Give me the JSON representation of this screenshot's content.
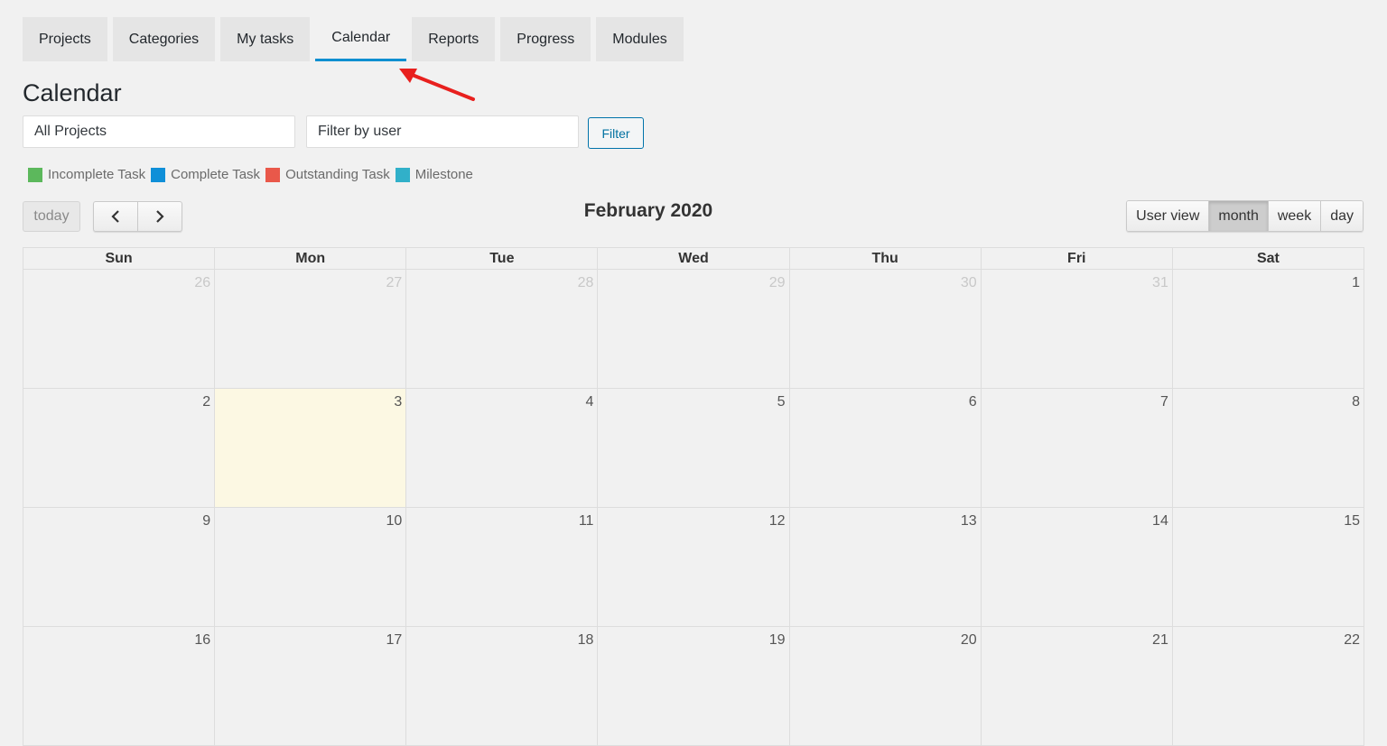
{
  "tabs": [
    {
      "label": "Projects",
      "active": false
    },
    {
      "label": "Categories",
      "active": false
    },
    {
      "label": "My tasks",
      "active": false
    },
    {
      "label": "Calendar",
      "active": true
    },
    {
      "label": "Reports",
      "active": false
    },
    {
      "label": "Progress",
      "active": false
    },
    {
      "label": "Modules",
      "active": false
    }
  ],
  "page_title": "Calendar",
  "filters": {
    "project_value": "All Projects",
    "user_placeholder": "Filter by user",
    "filter_button": "Filter"
  },
  "legend": [
    {
      "label": "Incomplete Task",
      "color": "#5cb85c"
    },
    {
      "label": "Complete Task",
      "color": "#0f8fd8"
    },
    {
      "label": "Outstanding Task",
      "color": "#e9584a"
    },
    {
      "label": "Milestone",
      "color": "#31b0c9"
    }
  ],
  "toolbar": {
    "today_label": "today",
    "prev_icon": "‹",
    "next_icon": "›",
    "title": "February 2020",
    "views": [
      {
        "label": "User view",
        "active": false
      },
      {
        "label": "month",
        "active": true
      },
      {
        "label": "week",
        "active": false
      },
      {
        "label": "day",
        "active": false
      }
    ]
  },
  "calendar": {
    "weekdays": [
      "Sun",
      "Mon",
      "Tue",
      "Wed",
      "Thu",
      "Fri",
      "Sat"
    ],
    "weeks": [
      [
        {
          "d": "26",
          "other": true
        },
        {
          "d": "27",
          "other": true
        },
        {
          "d": "28",
          "other": true
        },
        {
          "d": "29",
          "other": true
        },
        {
          "d": "30",
          "other": true
        },
        {
          "d": "31",
          "other": true
        },
        {
          "d": "1"
        }
      ],
      [
        {
          "d": "2"
        },
        {
          "d": "3",
          "today": true
        },
        {
          "d": "4"
        },
        {
          "d": "5"
        },
        {
          "d": "6"
        },
        {
          "d": "7"
        },
        {
          "d": "8"
        }
      ],
      [
        {
          "d": "9"
        },
        {
          "d": "10"
        },
        {
          "d": "11"
        },
        {
          "d": "12"
        },
        {
          "d": "13"
        },
        {
          "d": "14"
        },
        {
          "d": "15"
        }
      ],
      [
        {
          "d": "16"
        },
        {
          "d": "17"
        },
        {
          "d": "18"
        },
        {
          "d": "19"
        },
        {
          "d": "20"
        },
        {
          "d": "21"
        },
        {
          "d": "22"
        }
      ]
    ]
  },
  "annotation": {
    "color": "#e8201e"
  }
}
